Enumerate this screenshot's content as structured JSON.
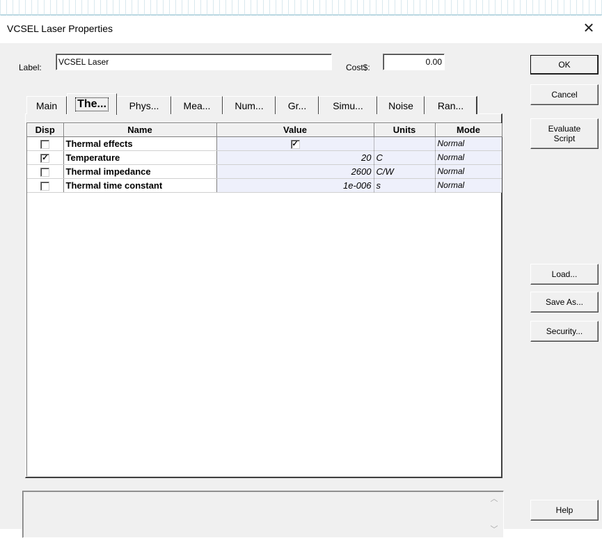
{
  "window": {
    "title": "VCSEL Laser Properties",
    "close_glyph": "✕"
  },
  "label_field": {
    "label": "Label:",
    "value": "VCSEL Laser"
  },
  "cost_field": {
    "label": "Cost$:",
    "value": "0.00"
  },
  "buttons": {
    "ok": "OK",
    "cancel": "Cancel",
    "evaluate": "Evaluate Script",
    "load": "Load...",
    "save_as": "Save As...",
    "security": "Security...",
    "help": "Help"
  },
  "tabs": [
    "Main",
    "The...",
    "Phys...",
    "Mea...",
    "Num...",
    "Gr...",
    "Simu...",
    "Noise",
    "Ran..."
  ],
  "active_tab": "The...",
  "table": {
    "headers": [
      "Disp",
      "Name",
      "Value",
      "Units",
      "Mode"
    ],
    "rows": [
      {
        "disp": false,
        "name": "Thermal effects",
        "value": "",
        "value_checked": true,
        "units": "",
        "mode": "Normal"
      },
      {
        "disp": true,
        "name": "Temperature",
        "value": "20",
        "units": "C",
        "mode": "Normal"
      },
      {
        "disp": false,
        "name": "Thermal impedance",
        "value": "2600",
        "units": "C/W",
        "mode": "Normal"
      },
      {
        "disp": false,
        "name": "Thermal time constant",
        "value": "1e-006",
        "units": "s",
        "mode": "Normal"
      }
    ]
  },
  "icons": {
    "check": "check-icon",
    "scroll_up": "scroll-up-icon",
    "scroll_down": "scroll-down-icon",
    "close": "close-icon"
  },
  "colors": {
    "grid_value_bg": "#eef0fb",
    "dialog_bg": "#f0f0f0"
  }
}
